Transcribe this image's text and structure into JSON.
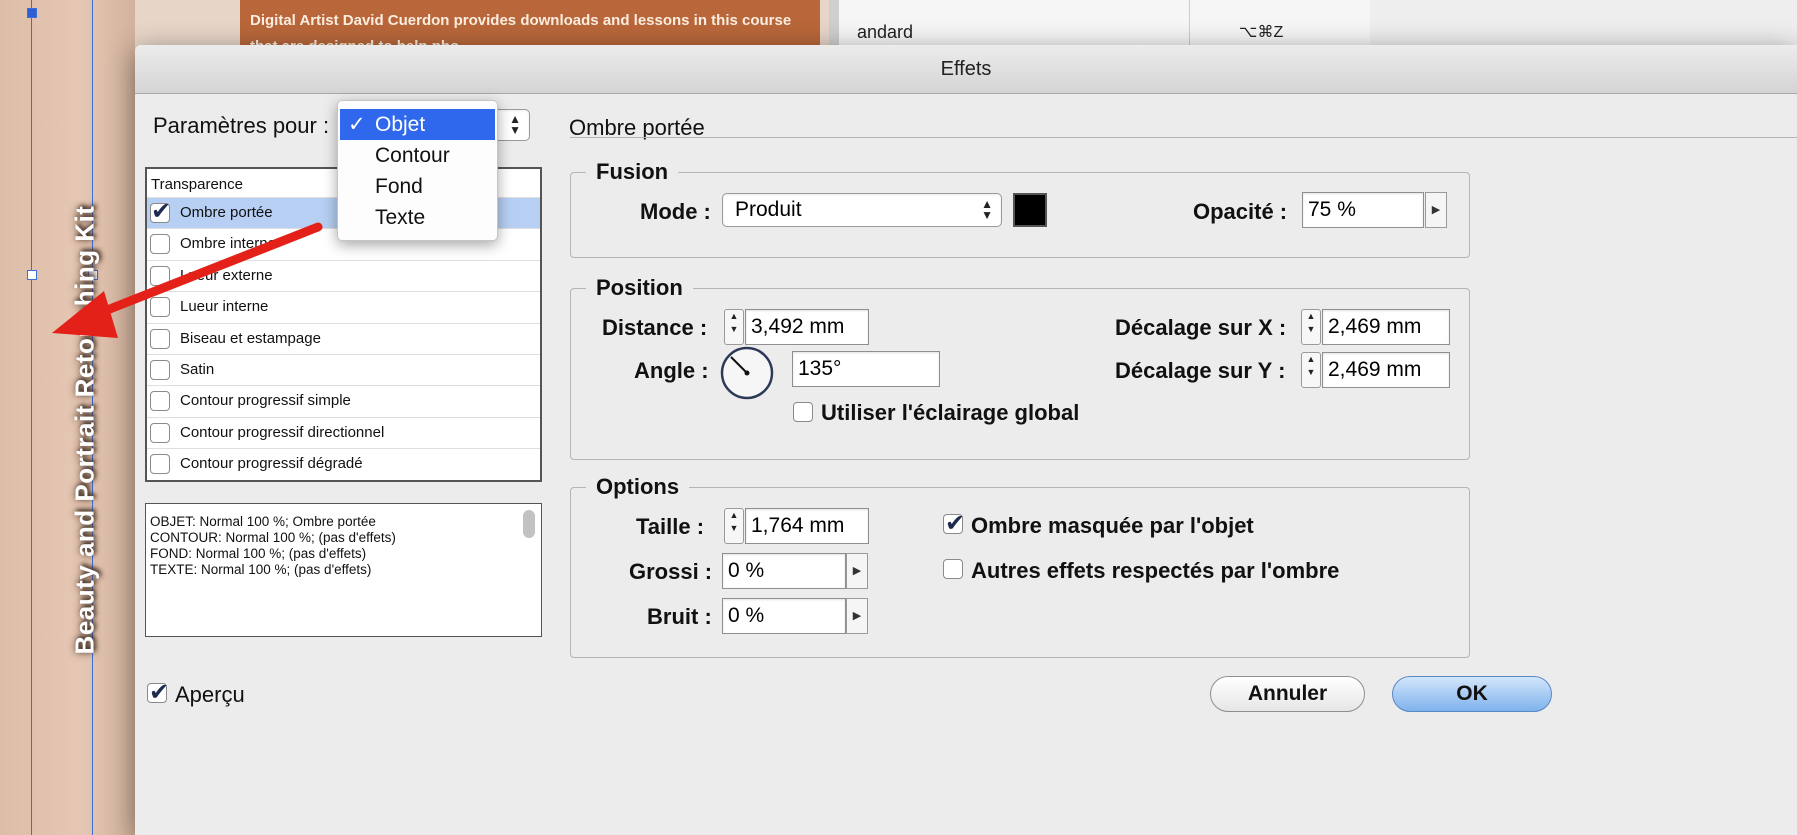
{
  "background": {
    "vertical_title": "Beauty and Portrait Retouching Kit",
    "text_block": "Digital Artist David Cuerdon provides downloads and lessons in this course that are designed to help pho",
    "menu_label": "andard",
    "menu_shortcut": "⌥⌘Z"
  },
  "dialog": {
    "title": "Effets",
    "settings_for_label": "Paramètres pour :",
    "settings_for_popup": {
      "items": [
        "Objet",
        "Contour",
        "Fond",
        "Texte"
      ],
      "selected": "Objet",
      "check_glyph": "✓"
    },
    "effects_list": {
      "header": "Transparence",
      "items": [
        {
          "label": "Ombre portée",
          "checked": true,
          "selected": true
        },
        {
          "label": "Ombre interne",
          "checked": false,
          "selected": false
        },
        {
          "label": "Lueur externe",
          "checked": false,
          "selected": false
        },
        {
          "label": "Lueur interne",
          "checked": false,
          "selected": false
        },
        {
          "label": "Biseau et estampage",
          "checked": false,
          "selected": false
        },
        {
          "label": "Satin",
          "checked": false,
          "selected": false
        },
        {
          "label": "Contour progressif simple",
          "checked": false,
          "selected": false
        },
        {
          "label": "Contour progressif directionnel",
          "checked": false,
          "selected": false
        },
        {
          "label": "Contour progressif dégradé",
          "checked": false,
          "selected": false
        }
      ]
    },
    "summary_lines": [
      "OBJET: Normal 100 %; Ombre portée",
      "CONTOUR: Normal 100 %; (pas d'effets)",
      "FOND: Normal 100 %; (pas d'effets)",
      "TEXTE: Normal 100 %; (pas d'effets)"
    ],
    "preview": {
      "label": "Aperçu",
      "checked": true
    },
    "section_title": "Ombre portée",
    "fusion": {
      "title": "Fusion",
      "mode_label": "Mode :",
      "mode_value": "Produit",
      "color_swatch": "#000000",
      "opacity_label": "Opacité :",
      "opacity_value": "75 %"
    },
    "position": {
      "title": "Position",
      "distance_label": "Distance :",
      "distance_value": "3,492 mm",
      "angle_label": "Angle :",
      "angle_value": "135°",
      "global_light_label": "Utiliser l'éclairage global",
      "global_light_checked": false,
      "offset_x_label": "Décalage sur X :",
      "offset_x_value": "2,469 mm",
      "offset_y_label": "Décalage sur Y :",
      "offset_y_value": "2,469 mm"
    },
    "options": {
      "title": "Options",
      "size_label": "Taille :",
      "size_value": "1,764 mm",
      "spread_label": "Grossi :",
      "spread_value": "0 %",
      "noise_label": "Bruit :",
      "noise_value": "0 %",
      "knockout_label": "Ombre masquée par l'objet",
      "knockout_checked": true,
      "honor_effects_label": "Autres effets respectés par l'ombre",
      "honor_effects_checked": false
    },
    "buttons": {
      "cancel": "Annuler",
      "ok": "OK"
    }
  },
  "colors": {
    "accent_blue": "#2f67ed",
    "selection_row": "#b6cff2",
    "annotation_arrow": "#e32119",
    "ok_button": "#7fb2ec"
  }
}
